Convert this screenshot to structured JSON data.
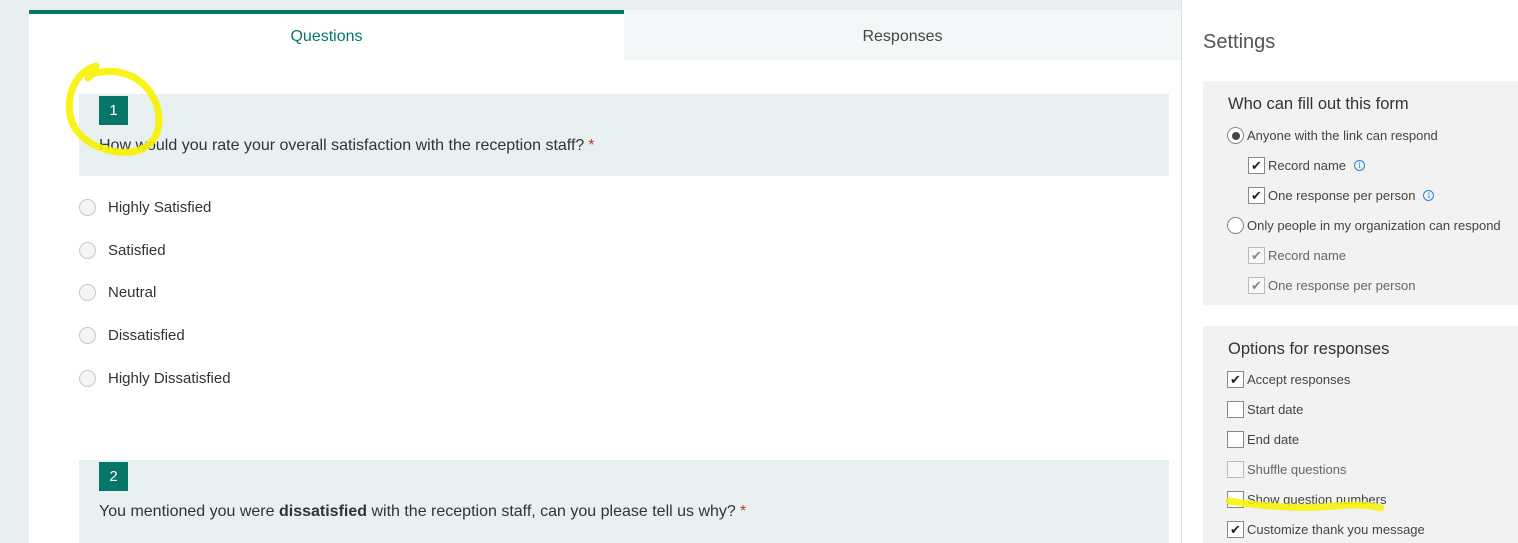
{
  "tabs": {
    "questions": "Questions",
    "responses": "Responses"
  },
  "questions": [
    {
      "number": "1",
      "text": "How would you rate your overall satisfaction with the reception staff?",
      "required_mark": "*",
      "options": [
        "Highly Satisfied",
        "Satisfied",
        "Neutral",
        "Dissatisfied",
        "Highly Dissatisfied"
      ]
    },
    {
      "number": "2",
      "text_before": "You mentioned you were ",
      "text_bold": "dissatisfied",
      "text_after": " with the reception staff, can you please tell us why?",
      "required_mark": "*"
    }
  ],
  "settings": {
    "title": "Settings",
    "who_card": {
      "title": "Who can fill out this form",
      "anyone_label": "Anyone with the link can respond",
      "anyone_selected": true,
      "anyone_record_name": "Record name",
      "anyone_one_response": "One response per person",
      "org_label": "Only people in my organization can respond",
      "org_record_name": "Record name",
      "org_one_response": "One response per person",
      "info_glyph": "i"
    },
    "options_card": {
      "title": "Options for responses",
      "accept_responses": "Accept responses",
      "start_date": "Start date",
      "end_date": "End date",
      "shuffle_questions": "Shuffle questions",
      "show_question_numbers": "Show question numbers",
      "customize_thank_you": "Customize thank you message"
    }
  },
  "colors": {
    "accent": "#077568",
    "highlight": "#ffff00",
    "required": "#c0392b"
  }
}
